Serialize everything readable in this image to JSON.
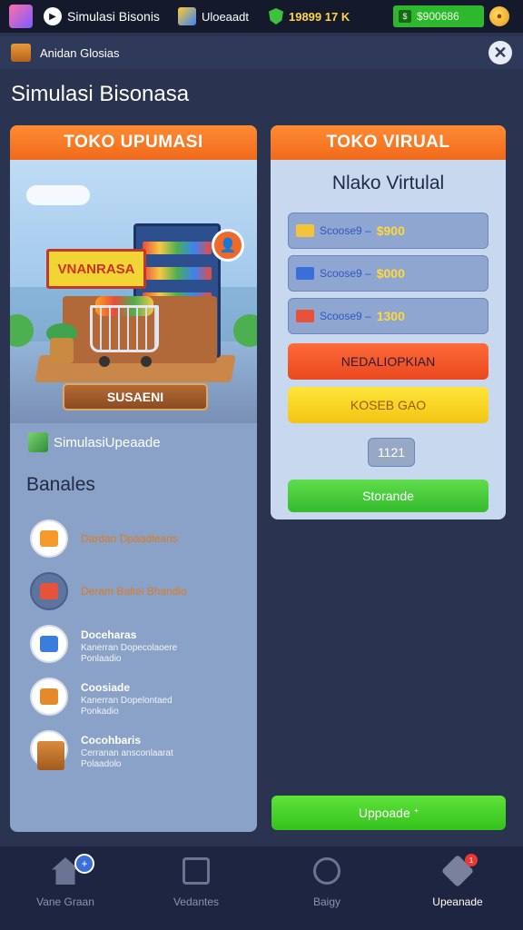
{
  "topbar": {
    "app_title": "Simulasi Bisonis",
    "user_name": "Uloeaadt",
    "score": "19899 17 K",
    "cash": "$900686",
    "play_glyph": "▶",
    "coin_glyph": "●"
  },
  "breadcrumb": {
    "text": "Anidan Glosias",
    "close_glyph": "✕"
  },
  "page_title": "Simulasi Bisonasa",
  "left_panel": {
    "header": "TOKO UPUMASI",
    "scene": {
      "awning_text": "VNANRASA",
      "sign_text": "SUSAENI",
      "badge_glyph": "👤"
    },
    "sim_label": "SimulasiUpeaade",
    "section_title": "Banales",
    "items": [
      {
        "title": "Dardan Dpaadlearis",
        "desc": "",
        "color": "#f59a2a"
      },
      {
        "title": "Deram Baltei Bhandio",
        "desc": "",
        "color": "#e5533a"
      },
      {
        "title": "Doceharas",
        "desc": "Kanerran Dopecolaoere Ponlaadio",
        "color": "#3b7ddd"
      },
      {
        "title": "Coosiade",
        "desc": "Kanerran Dopelontaed Ponkadio",
        "color": "#e58a2a"
      },
      {
        "title": "Cocohbaris",
        "desc": "Cerranan ansconlaarat Polaadolo",
        "color": "#4caf50"
      }
    ]
  },
  "right_panel": {
    "header": "TOKO VIRUAL",
    "title": "Nlako Virtulal",
    "prices": [
      {
        "label": "Scoose9 –",
        "value": "$900",
        "color": "#f3c43a"
      },
      {
        "label": "Scoose9 –",
        "value": "$000",
        "color": "#3b6fd8"
      },
      {
        "label": "Scoose9 –",
        "value": "1300",
        "color": "#e5533a"
      }
    ],
    "btn_red": "NEDALIOPKIAN",
    "btn_yellow": "KOSEB GAO",
    "btn_small": "1121",
    "btn_green": "Storande"
  },
  "upgrade_button": "Uppoade ᐩ",
  "bottom_nav": [
    {
      "label": "Vane Graan",
      "icon": "home-icon",
      "badge": "+"
    },
    {
      "label": "Vedantes",
      "icon": "chart-icon",
      "badge": ""
    },
    {
      "label": "Baigy",
      "icon": "clock-icon",
      "badge": ""
    },
    {
      "label": "Upeanade",
      "icon": "upgrade-icon",
      "badge": "1"
    }
  ]
}
